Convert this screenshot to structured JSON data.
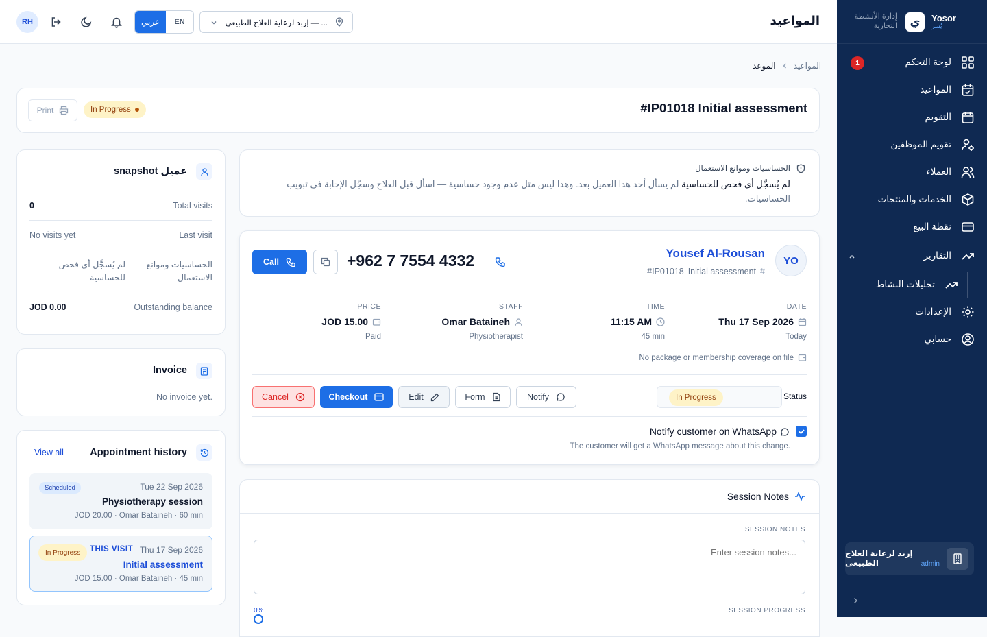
{
  "brand": {
    "name": "Yosor",
    "sub": "يُسر",
    "desc": "إدارة الأنشطة التجارية"
  },
  "sidebar": {
    "items": [
      {
        "label": "لوحة التحكم",
        "icon": "dashboard-icon",
        "badge": "1"
      },
      {
        "label": "المواعيد",
        "icon": "calendar-check-icon"
      },
      {
        "label": "التقويم",
        "icon": "calendar-icon"
      },
      {
        "label": "تقويم الموظفين",
        "icon": "staff-calendar-icon"
      },
      {
        "label": "العملاء",
        "icon": "users-icon"
      },
      {
        "label": "الخدمات والمنتجات",
        "icon": "box-icon"
      },
      {
        "label": "نقطة البيع",
        "icon": "card-icon"
      },
      {
        "label": "التقارير",
        "icon": "trend-icon"
      },
      {
        "label": "تحليلات النشاط",
        "icon": "trend-icon"
      },
      {
        "label": "الإعدادات",
        "icon": "gear-icon"
      },
      {
        "label": "حسابي",
        "icon": "user-circle-icon"
      }
    ],
    "clinic": {
      "name": "إربد لرعاية العلاج الطبيعى",
      "role": "admin"
    }
  },
  "topbar": {
    "title": "المواعيد",
    "avatar": "RH",
    "lang_on": "عربي",
    "lang_off": "EN",
    "location": "إربد لرعاية العلاج الطبيعى — ..."
  },
  "breadcrumb": {
    "parent": "المواعيد",
    "current": "الموعد"
  },
  "header": {
    "title": "#IP01018 Initial assessment",
    "status": "In Progress",
    "print": "Print"
  },
  "allergy": {
    "title": "الحساسيات وموانع الاستعمال",
    "strong": "لم يُسجَّل أي فحص للحساسية",
    "line1": "لم يسأل أحد هذا العميل بعد. وهذا ليس مثل عدم وجود حساسية — اسأل قبل العلاج وسجّل الإجابة في تبويب",
    "line2": "الحساسيات."
  },
  "appointment": {
    "initials": "YO",
    "customer": "Yousef Al-Rousan",
    "ref": "#IP01018",
    "service": "Initial assessment",
    "phone": "+962 7 7554 4332",
    "call": "Call",
    "date_label": "DATE",
    "date": "Thu 17 Sep 2026",
    "date_sub": "Today",
    "time_label": "TIME",
    "time": "11:15 AM",
    "time_sub": "45 min",
    "staff_label": "STAFF",
    "staff": "Omar Bataineh",
    "staff_sub": "Physiotherapist",
    "price_label": "PRICE",
    "price": "JOD 15.00",
    "price_sub": "Paid",
    "coverage": "No package or membership coverage on file",
    "status_label": "Status",
    "status": "In Progress",
    "actions": {
      "notify": "Notify",
      "form": "Form",
      "edit": "Edit",
      "checkout": "Checkout",
      "cancel": "Cancel"
    },
    "whatsapp": "Notify customer on WhatsApp",
    "whatsapp_help": "The customer will get a WhatsApp message about this change."
  },
  "notes": {
    "title": "Session Notes",
    "label": "SESSION NOTES",
    "placeholder": "Enter session notes...",
    "progress_label": "SESSION PROGRESS",
    "progress": "0%"
  },
  "snapshot": {
    "title": "snapshot عميل",
    "rows": [
      {
        "label": "Total visits",
        "value": "0"
      },
      {
        "label": "Last visit",
        "value": "No visits yet"
      },
      {
        "label": "الحساسيات وموانع الاستعمال",
        "value": "لم يُسجَّل أي فحص للحساسية"
      },
      {
        "label": "Outstanding balance",
        "value": "JOD 0.00"
      }
    ]
  },
  "invoice": {
    "title": "Invoice",
    "empty": "No invoice yet."
  },
  "history": {
    "title": "Appointment history",
    "view_all": "View all",
    "items": [
      {
        "status": "Scheduled",
        "date": "Tue 22 Sep 2026",
        "service": "Physiotherapy session",
        "meta": "JOD 20.00 · Omar Bataineh · 60 min"
      },
      {
        "status": "In Progress",
        "this": "THIS VISIT",
        "date": "Thu 17 Sep 2026",
        "service": "Initial assessment",
        "meta": "JOD 15.00 · Omar Bataineh · 45 min"
      }
    ]
  },
  "colors": {
    "sidebar": "#0f2952",
    "accent": "#1d6ee6",
    "danger": "#dc2626",
    "warning_bg": "#fef3c7"
  }
}
